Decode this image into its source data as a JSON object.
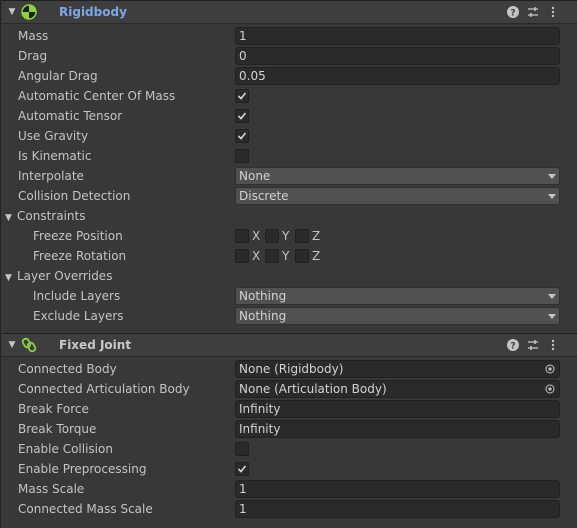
{
  "rigidbody": {
    "title": "Rigidbody",
    "mass": {
      "label": "Mass",
      "value": "1"
    },
    "drag": {
      "label": "Drag",
      "value": "0"
    },
    "angular_drag": {
      "label": "Angular Drag",
      "value": "0.05"
    },
    "auto_com": {
      "label": "Automatic Center Of Mass",
      "checked": true
    },
    "auto_tensor": {
      "label": "Automatic Tensor",
      "checked": true
    },
    "use_gravity": {
      "label": "Use Gravity",
      "checked": true
    },
    "is_kinematic": {
      "label": "Is Kinematic",
      "checked": false
    },
    "interpolate": {
      "label": "Interpolate",
      "value": "None"
    },
    "collision_detection": {
      "label": "Collision Detection",
      "value": "Discrete"
    },
    "constraints": {
      "label": "Constraints",
      "freeze_position": {
        "label": "Freeze Position",
        "axes": [
          "X",
          "Y",
          "Z"
        ]
      },
      "freeze_rotation": {
        "label": "Freeze Rotation",
        "axes": [
          "X",
          "Y",
          "Z"
        ]
      }
    },
    "layer_overrides": {
      "label": "Layer Overrides",
      "include_layers": {
        "label": "Include Layers",
        "value": "Nothing"
      },
      "exclude_layers": {
        "label": "Exclude Layers",
        "value": "Nothing"
      }
    }
  },
  "fixed_joint": {
    "title": "Fixed Joint",
    "connected_body": {
      "label": "Connected Body",
      "value": "None (Rigidbody)"
    },
    "connected_articulation_body": {
      "label": "Connected Articulation Body",
      "value": "None (Articulation Body)"
    },
    "break_force": {
      "label": "Break Force",
      "value": "Infinity"
    },
    "break_torque": {
      "label": "Break Torque",
      "value": "Infinity"
    },
    "enable_collision": {
      "label": "Enable Collision",
      "checked": false
    },
    "enable_preprocessing": {
      "label": "Enable Preprocessing",
      "checked": true
    },
    "mass_scale": {
      "label": "Mass Scale",
      "value": "1"
    },
    "connected_mass_scale": {
      "label": "Connected Mass Scale",
      "value": "1"
    }
  },
  "colors": {
    "background": "#383838",
    "header": "#3e3e3e",
    "field": "#2a2a2a",
    "dropdown": "#515151",
    "title_accent": "#7ea7e6",
    "icon_green": "#8bd43a"
  },
  "icons": [
    "rigidbody-icon",
    "fixed-joint-icon",
    "help-icon",
    "presets-icon",
    "more-icon",
    "object-picker-icon",
    "checkmark-icon"
  ]
}
